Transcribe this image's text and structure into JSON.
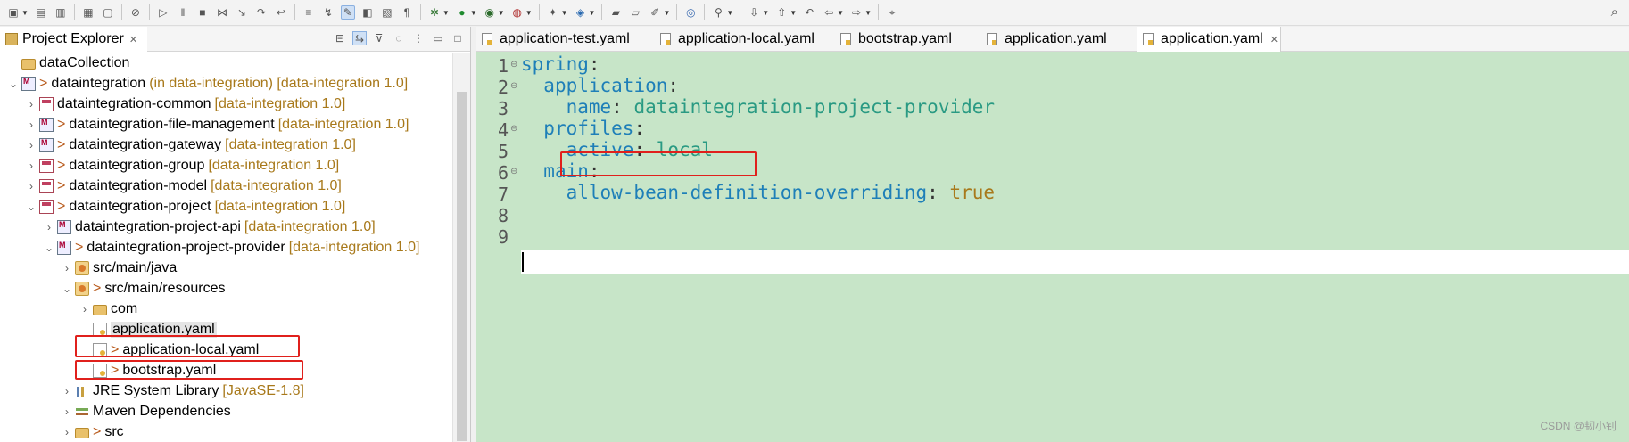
{
  "explorer": {
    "title": "Project Explorer",
    "tree": [
      {
        "label": "dataCollection",
        "decor": "",
        "prefix": "",
        "icon": "folder",
        "indent": 0,
        "chev": "",
        "selected": false
      },
      {
        "label": "dataintegration",
        "decor": "(in data-integration) [data-integration 1.0]",
        "prefix": ">",
        "icon": "maven",
        "indent": 0,
        "chev": "v",
        "selected": false
      },
      {
        "label": "dataintegration-common",
        "decor": "[data-integration 1.0]",
        "prefix": "",
        "icon": "project",
        "indent": 1,
        "chev": ">",
        "selected": false
      },
      {
        "label": "dataintegration-file-management",
        "decor": "[data-integration 1.0]",
        "prefix": ">",
        "icon": "maven",
        "indent": 1,
        "chev": ">",
        "selected": false
      },
      {
        "label": "dataintegration-gateway",
        "decor": "[data-integration 1.0]",
        "prefix": ">",
        "icon": "maven",
        "indent": 1,
        "chev": ">",
        "selected": false
      },
      {
        "label": "dataintegration-group",
        "decor": "[data-integration 1.0]",
        "prefix": ">",
        "icon": "project",
        "indent": 1,
        "chev": ">",
        "selected": false
      },
      {
        "label": "dataintegration-model",
        "decor": "[data-integration 1.0]",
        "prefix": ">",
        "icon": "project",
        "indent": 1,
        "chev": ">",
        "selected": false
      },
      {
        "label": "dataintegration-project",
        "decor": "[data-integration 1.0]",
        "prefix": ">",
        "icon": "project",
        "indent": 1,
        "chev": "v",
        "selected": false
      },
      {
        "label": "dataintegration-project-api",
        "decor": "[data-integration 1.0]",
        "prefix": "",
        "icon": "maven",
        "indent": 2,
        "chev": ">",
        "selected": false
      },
      {
        "label": "dataintegration-project-provider",
        "decor": "[data-integration 1.0]",
        "prefix": ">",
        "icon": "maven",
        "indent": 2,
        "chev": "v",
        "selected": false
      },
      {
        "label": "src/main/java",
        "decor": "",
        "prefix": "",
        "icon": "pkg",
        "indent": 3,
        "chev": ">",
        "selected": false
      },
      {
        "label": "src/main/resources",
        "decor": "",
        "prefix": ">",
        "icon": "pkg",
        "indent": 3,
        "chev": "v",
        "selected": false
      },
      {
        "label": "com",
        "decor": "",
        "prefix": "",
        "icon": "folder",
        "indent": 4,
        "chev": ">",
        "selected": false
      },
      {
        "label": "application.yaml",
        "decor": "",
        "prefix": "",
        "icon": "yaml",
        "indent": 4,
        "chev": "",
        "selected": true
      },
      {
        "label": "application-local.yaml",
        "decor": "",
        "prefix": ">",
        "icon": "yaml",
        "indent": 4,
        "chev": "",
        "selected": false
      },
      {
        "label": "bootstrap.yaml",
        "decor": "",
        "prefix": ">",
        "icon": "yaml",
        "indent": 4,
        "chev": "",
        "selected": false
      },
      {
        "label": "JRE System Library",
        "decor": "[JavaSE-1.8]",
        "prefix": "",
        "icon": "lib",
        "indent": 3,
        "chev": ">",
        "selected": false
      },
      {
        "label": "Maven Dependencies",
        "decor": "",
        "prefix": "",
        "icon": "dep",
        "indent": 3,
        "chev": ">",
        "selected": false
      },
      {
        "label": "src",
        "decor": "",
        "prefix": ">",
        "icon": "folder",
        "indent": 3,
        "chev": ">",
        "selected": false
      }
    ]
  },
  "editor": {
    "tabs": [
      {
        "label": "application-test.yaml",
        "active": false
      },
      {
        "label": "application-local.yaml",
        "active": false
      },
      {
        "label": "bootstrap.yaml",
        "active": false
      },
      {
        "label": "application.yaml",
        "active": false
      },
      {
        "label": "application.yaml",
        "active": true
      }
    ],
    "lines": [
      {
        "num": "1",
        "fold": true,
        "tokens": [
          {
            "t": "spring",
            "c": "k"
          },
          {
            "t": ":",
            "c": "p"
          }
        ]
      },
      {
        "num": "2",
        "fold": true,
        "tokens": [
          {
            "t": "  ",
            "c": "p"
          },
          {
            "t": "application",
            "c": "k"
          },
          {
            "t": ":",
            "c": "p"
          }
        ]
      },
      {
        "num": "3",
        "fold": false,
        "tokens": [
          {
            "t": "    ",
            "c": "p"
          },
          {
            "t": "name",
            "c": "k"
          },
          {
            "t": ": ",
            "c": "p"
          },
          {
            "t": "dataintegration-project-provider",
            "c": "v"
          }
        ]
      },
      {
        "num": "4",
        "fold": true,
        "tokens": [
          {
            "t": "  ",
            "c": "p"
          },
          {
            "t": "profiles",
            "c": "k"
          },
          {
            "t": ":",
            "c": "p"
          }
        ]
      },
      {
        "num": "5",
        "fold": false,
        "tokens": [
          {
            "t": "    ",
            "c": "p"
          },
          {
            "t": "active",
            "c": "k"
          },
          {
            "t": ": ",
            "c": "p"
          },
          {
            "t": "local",
            "c": "v"
          }
        ]
      },
      {
        "num": "6",
        "fold": true,
        "tokens": [
          {
            "t": "  ",
            "c": "p"
          },
          {
            "t": "main",
            "c": "k"
          },
          {
            "t": ":",
            "c": "p"
          }
        ]
      },
      {
        "num": "7",
        "fold": false,
        "tokens": [
          {
            "t": "    ",
            "c": "p"
          },
          {
            "t": "allow-bean-definition-overriding",
            "c": "k"
          },
          {
            "t": ": ",
            "c": "p"
          },
          {
            "t": "true",
            "c": "b"
          }
        ]
      },
      {
        "num": "8",
        "fold": false,
        "tokens": []
      },
      {
        "num": "9",
        "fold": false,
        "tokens": []
      }
    ]
  },
  "watermark": "CSDN @韧小钊",
  "colors": {
    "editor_bg": "#c7e5c8",
    "highlight": "#e0201c",
    "key": "#1e7fb8",
    "value": "#2a9a83"
  }
}
